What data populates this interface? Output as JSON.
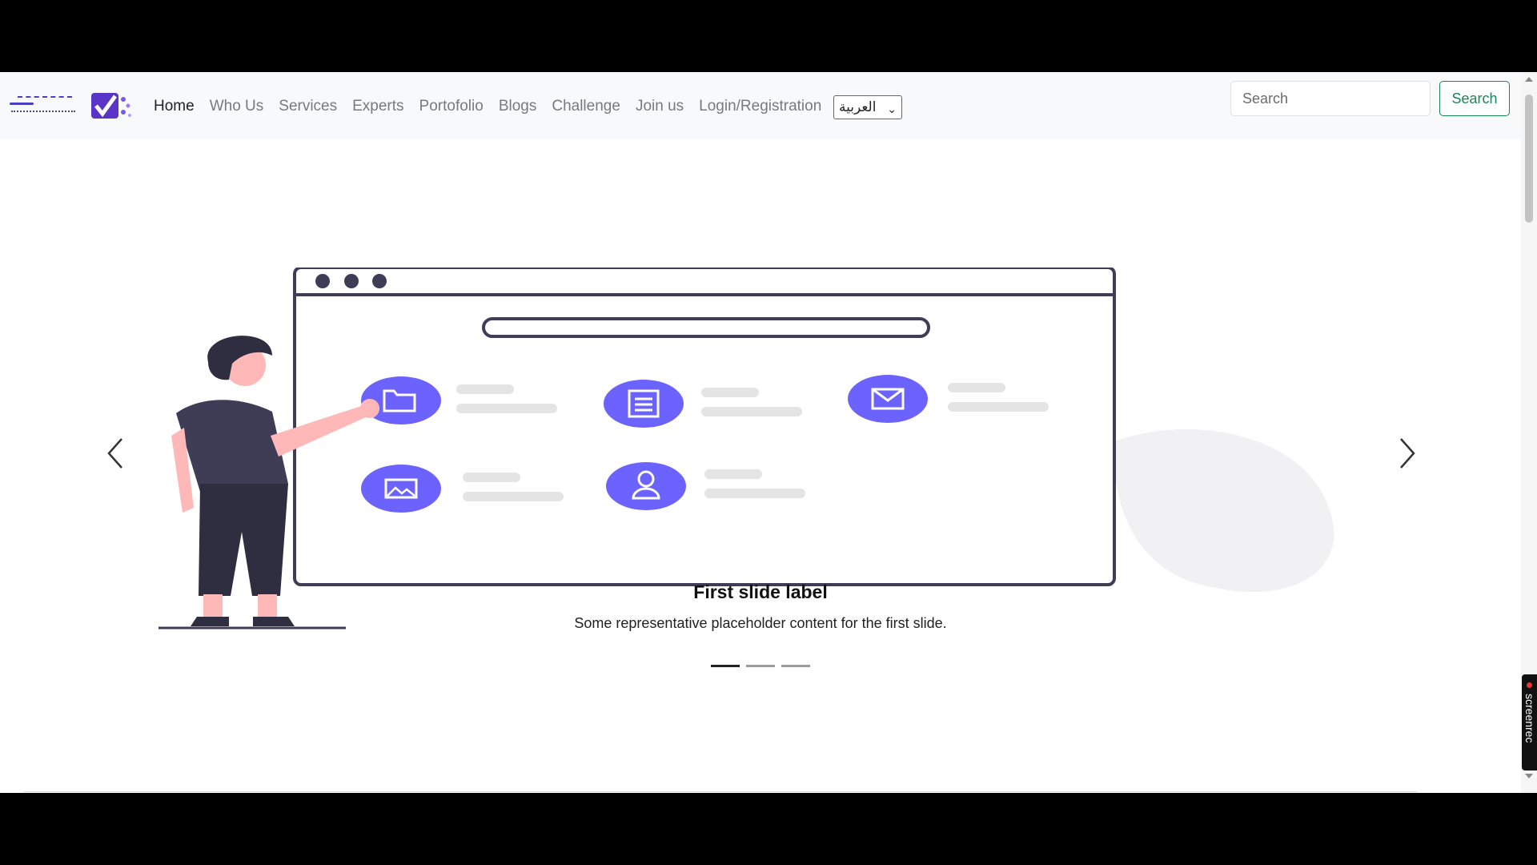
{
  "brand": {
    "logo_alt": "logo"
  },
  "nav": {
    "items": [
      {
        "label": "Home",
        "active": true
      },
      {
        "label": "Who Us"
      },
      {
        "label": "Services"
      },
      {
        "label": "Experts"
      },
      {
        "label": "Portofolio"
      },
      {
        "label": "Blogs"
      },
      {
        "label": "Challenge"
      },
      {
        "label": "Join us"
      },
      {
        "label": "Login/Registration"
      }
    ],
    "language": {
      "selected": "العربية"
    }
  },
  "search": {
    "placeholder": "Search",
    "value": "",
    "button_label": "Search"
  },
  "carousel": {
    "slide_label": "First slide label",
    "slide_caption": "Some representative placeholder content for the first slide.",
    "indicators": 3,
    "active_index": 0,
    "prev_icon": "chevron-left-icon",
    "next_icon": "chevron-right-icon"
  },
  "colors": {
    "accent": "#6c63ff",
    "success": "#198754"
  },
  "overlay": {
    "recorder_label": "screenrec"
  }
}
